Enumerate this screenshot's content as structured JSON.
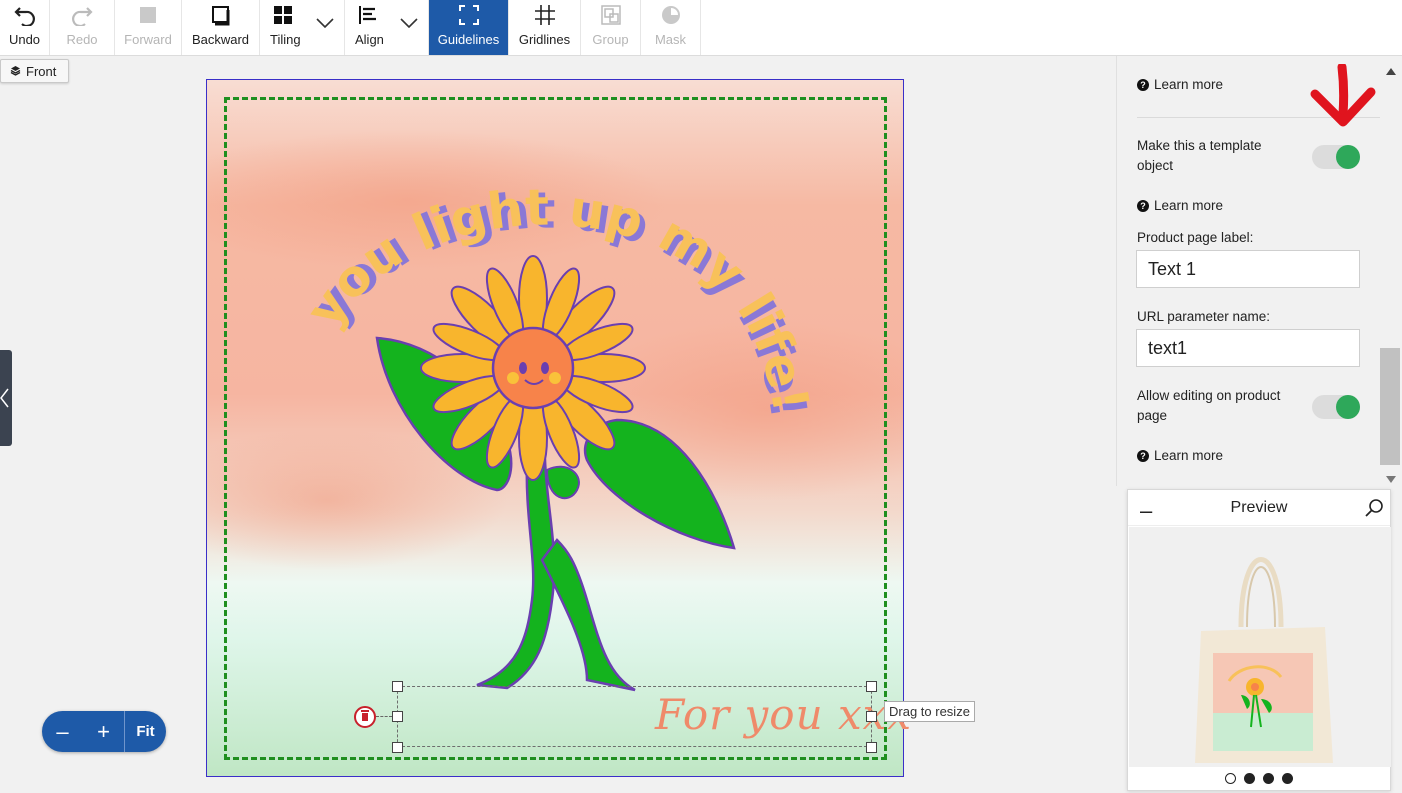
{
  "toolbar": {
    "undo": "Undo",
    "redo": "Redo",
    "forward": "Forward",
    "backward": "Backward",
    "tiling": "Tiling",
    "align": "Align",
    "guidelines": "Guidelines",
    "gridlines": "Gridlines",
    "group": "Group",
    "mask": "Mask"
  },
  "side_tab": {
    "label": "Front"
  },
  "design": {
    "headline": "you light up my life!",
    "selected_text": "For you xxx",
    "resize_tooltip": "Drag to resize"
  },
  "zoom": {
    "minus": "–",
    "plus": "+",
    "fit": "Fit"
  },
  "panel": {
    "learn_more_1": "Learn more",
    "template_label": "Make this a template object",
    "template_enabled": true,
    "learn_more_2": "Learn more",
    "product_label_title": "Product page label:",
    "product_label_value": "Text 1",
    "url_param_title": "URL parameter name:",
    "url_param_value": "text1",
    "allow_edit_label": "Allow editing on product page",
    "allow_edit_enabled": true,
    "learn_more_3": "Learn more"
  },
  "preview": {
    "title": "Preview",
    "minimize": "–",
    "pages": 4,
    "current_page": 1
  },
  "colors": {
    "accent": "#1e5aa8",
    "toggle_on": "#2ea85a",
    "safe_area": "#1f8f1f",
    "bleed_border": "#3a2fc8",
    "annotation_arrow": "#e0141e"
  }
}
